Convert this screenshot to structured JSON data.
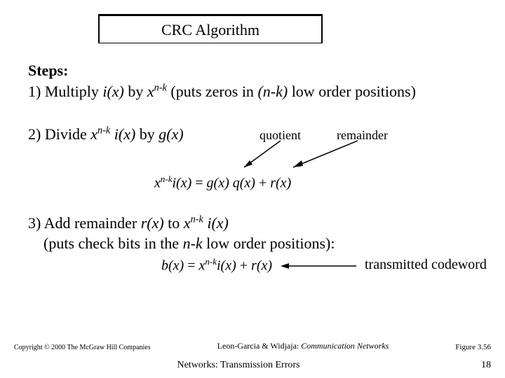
{
  "title": "CRC Algorithm",
  "steps_heading": "Steps:",
  "step1": {
    "num": "1)",
    "pre": "  Multiply ",
    "ix": "i(x)",
    "by": " by ",
    "xnk": "x",
    "xnk_sup": "n-k",
    "tail": " (puts zeros in ",
    "nk": "(n-k)",
    "tail2": " low order positions)"
  },
  "step2": {
    "num": "2)",
    "pre": "  Divide ",
    "xnk": "x",
    "xnk_sup": "n-k",
    "ix": " i(x)",
    "by": " by ",
    "gx": "g(x)",
    "quotient_label": "quotient",
    "remainder_label": "remainder"
  },
  "eq1": {
    "lhs_x": "x",
    "lhs_sup": "n-k",
    "lhs_ix": "i(x)",
    "eq": " = ",
    "rhs1": "g(x) q(x)",
    "plus": " + ",
    "rhs2": "r(x)"
  },
  "step3": {
    "num": "3)",
    "pre": "  Add remainder ",
    "rx": "r(x)",
    "mid": " to ",
    "xnk": "x",
    "xnk_sup": "n-k",
    "ix": " i(x)",
    "line2a": "    (puts check bits in the ",
    "nk": "n-k",
    "line2b": " low order positions):"
  },
  "eq2": {
    "bx": "b(x)",
    "eq": " = ",
    "x": "x",
    "sup": "n-k",
    "ix": "i(x)",
    "plus": " + ",
    "rx": "r(x)",
    "tx_label": "transmitted codeword"
  },
  "footer": {
    "copyright": "Copyright © 2000 The McGraw Hill Companies",
    "ref_plain": "Leon-Garcia & Widjaja: ",
    "ref_italic": "Communication Networks",
    "fig": "Figure 3.56",
    "bottom_center": "Networks: Transmission Errors",
    "page": "18"
  }
}
